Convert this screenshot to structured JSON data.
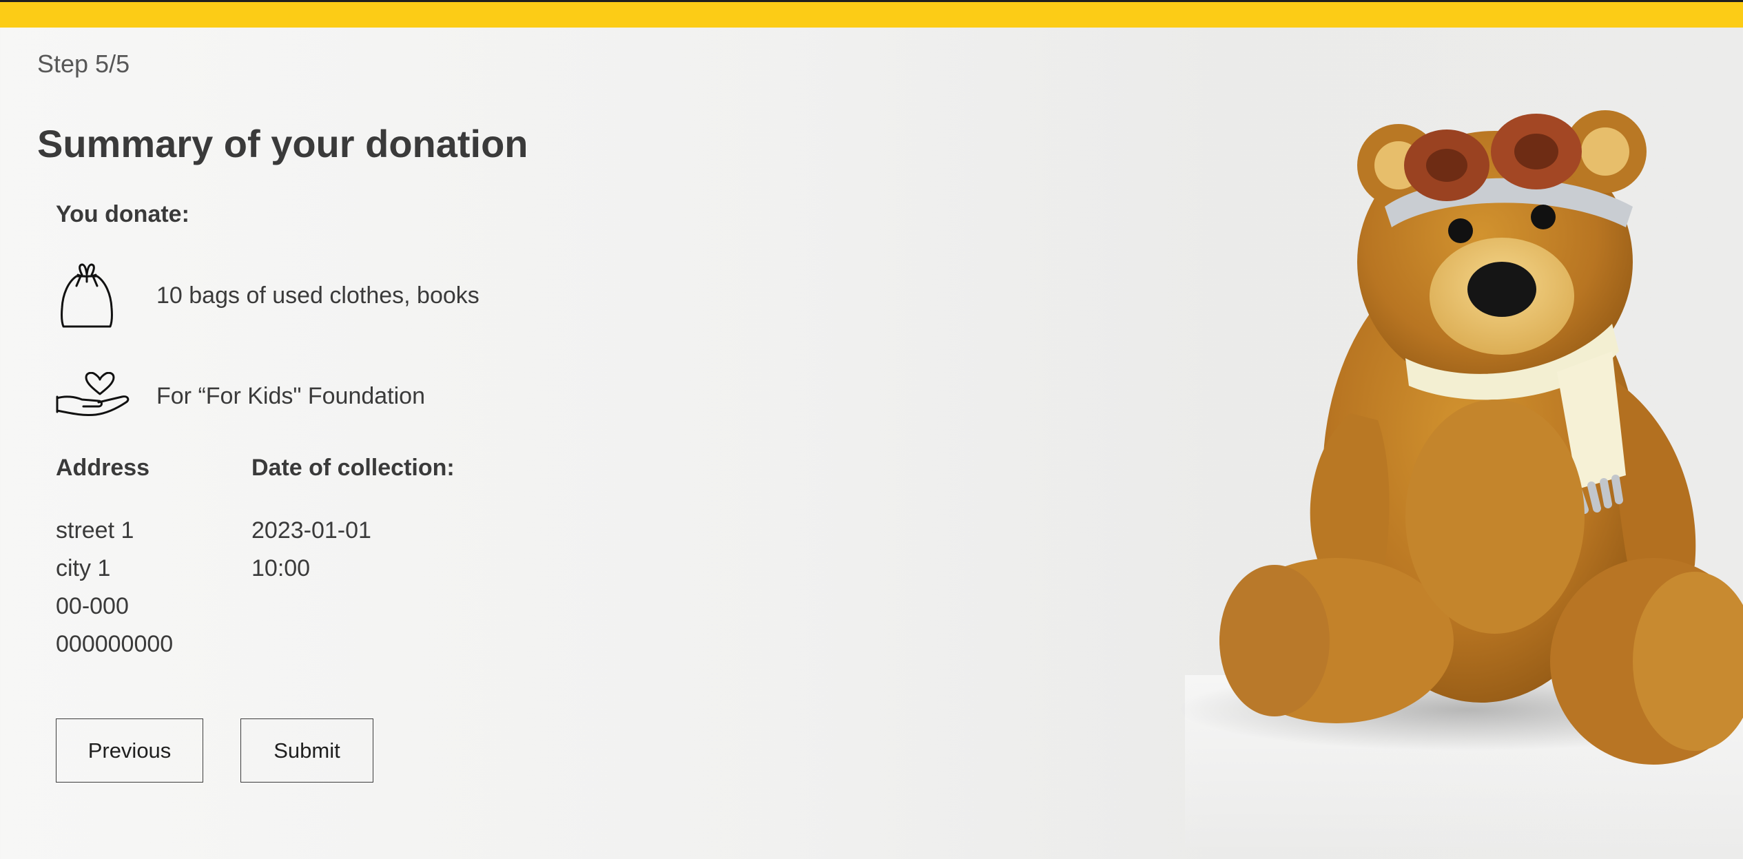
{
  "step": "Step 5/5",
  "title": "Summary of your donation",
  "donate_label": "You donate:",
  "items": {
    "bags": {
      "icon": "bag-icon",
      "text": "10 bags of used clothes, books"
    },
    "foundation": {
      "icon": "hand-heart-icon",
      "text": "For “For Kids\" Foundation"
    }
  },
  "address": {
    "label": "Address",
    "lines": [
      "street 1",
      "city 1",
      "00-000",
      "000000000"
    ]
  },
  "collection": {
    "label": "Date of collection:",
    "lines": [
      "2023-01-01",
      "10:00"
    ]
  },
  "buttons": {
    "previous": "Previous",
    "submit": "Submit"
  },
  "colors": {
    "accent": "#fccc16",
    "text": "#3a3a3a"
  },
  "image": "teddy-bear-illustration"
}
